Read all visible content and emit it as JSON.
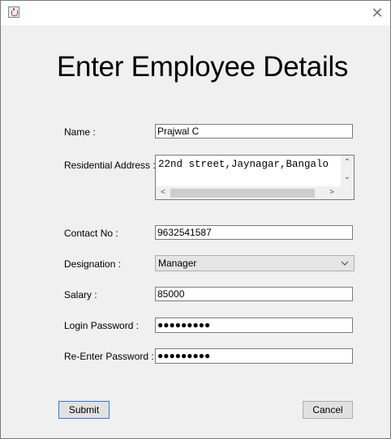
{
  "window": {
    "close_symbol": "✕"
  },
  "heading": "Enter Employee Details",
  "form": {
    "name_label": "Name :",
    "name_value": "Prajwal C",
    "address_label": "Residential Address :",
    "address_value": "22nd street,Jaynagar,Bangalo",
    "contact_label": "Contact No :",
    "contact_value": "9632541587",
    "designation_label": "Designation :",
    "designation_value": "Manager",
    "salary_label": "Salary :",
    "salary_value": "85000",
    "login_password_label": "Login Password :",
    "login_password_mask": "●●●●●●●●●",
    "reenter_password_label": "Re-Enter Password :",
    "reenter_password_mask": "●●●●●●●●●"
  },
  "scroll_arrows": {
    "up": "⌃",
    "down": "⌄",
    "left": "<",
    "right": ">"
  },
  "buttons": {
    "submit": "Submit",
    "cancel": "Cancel"
  },
  "icons": {
    "app": "java-cup-icon",
    "close": "close-icon",
    "dropdown": "chevron-down-icon"
  }
}
